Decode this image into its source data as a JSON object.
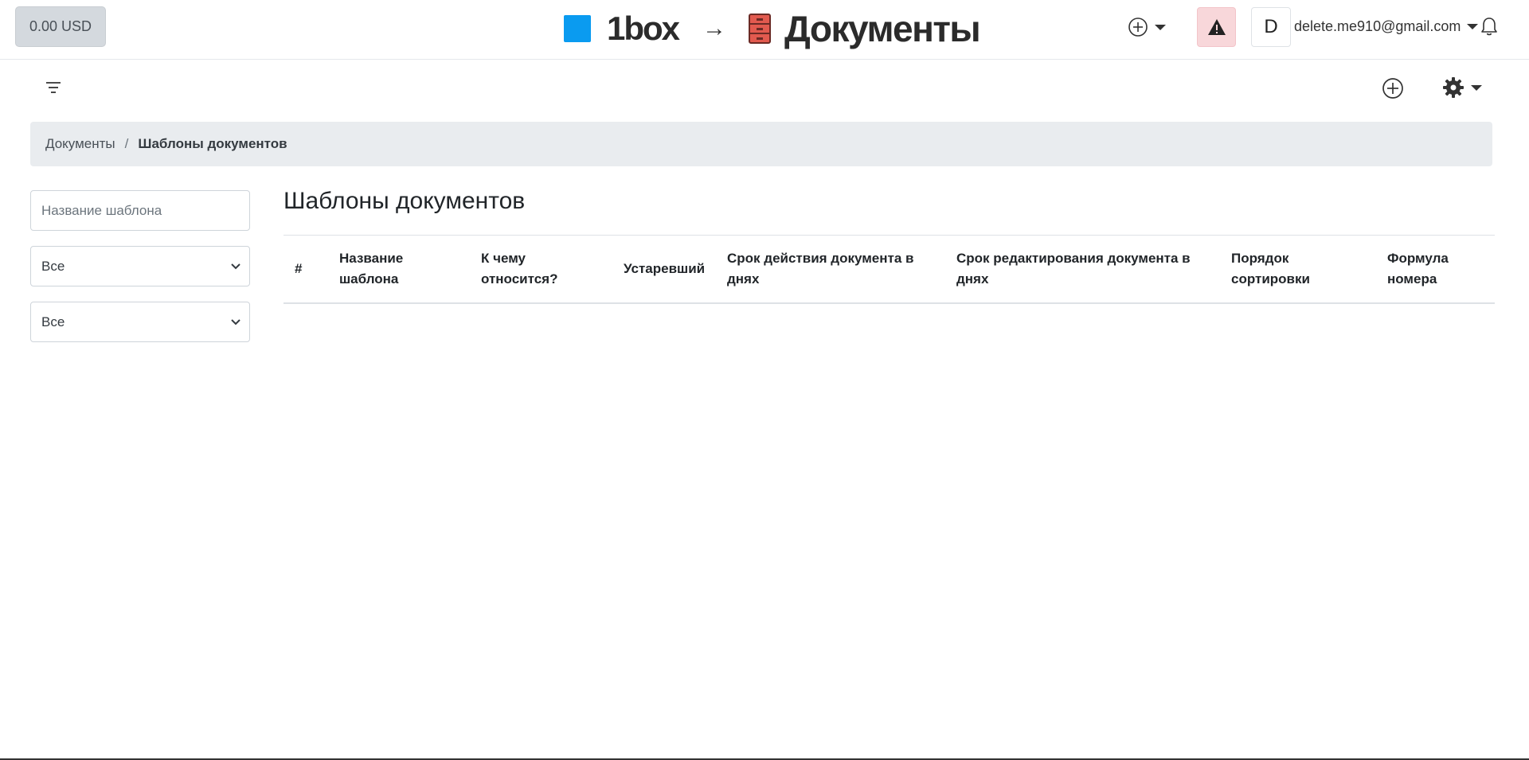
{
  "header": {
    "balance": "0.00 USD",
    "brand": "1box",
    "arrow": "→",
    "module": "Документы",
    "avatar_letter": "D",
    "user_email": "delete.me910@gmail.com"
  },
  "breadcrumb": {
    "items": [
      "Документы",
      "Шаблоны документов"
    ],
    "separator": "/"
  },
  "filters": {
    "name_placeholder": "Название шаблона",
    "select1_value": "Все",
    "select2_value": "Все"
  },
  "main": {
    "title": "Шаблоны документов",
    "columns": [
      "#",
      "Название шаблона",
      "К чему относится?",
      "Устаревший",
      "Срок действия документа в днях",
      "Срок редактирования документа в днях",
      "Порядок сортировки",
      "Формула номера"
    ],
    "rows": []
  },
  "icons": {
    "brand_square_color": "#0a9bf0",
    "alert_bg": "#f8d7da",
    "icon_names": [
      "plus-circle-icon",
      "warning-icon",
      "bell-icon",
      "filter-icon",
      "gear-icon",
      "chevron-down-icon",
      "file-cabinet-icon"
    ]
  }
}
